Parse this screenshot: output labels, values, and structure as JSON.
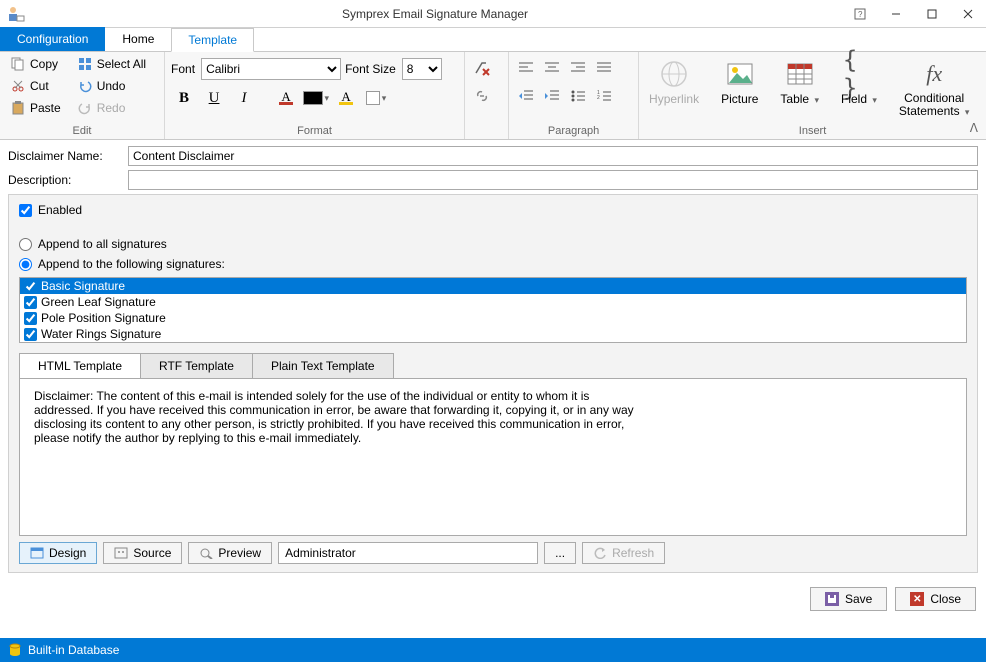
{
  "window": {
    "title": "Symprex Email Signature Manager"
  },
  "tabs": {
    "config": "Configuration",
    "home": "Home",
    "template": "Template"
  },
  "ribbon": {
    "edit": {
      "label": "Edit",
      "copy": "Copy",
      "cut": "Cut",
      "paste": "Paste",
      "select_all": "Select All",
      "undo": "Undo",
      "redo": "Redo"
    },
    "format": {
      "label": "Format",
      "font_label": "Font",
      "font_value": "Calibri",
      "size_label": "Font Size",
      "size_value": "8"
    },
    "paragraph": {
      "label": "Paragraph"
    },
    "insert": {
      "label": "Insert",
      "hyperlink": "Hyperlink",
      "picture": "Picture",
      "table": "Table",
      "field": "Field",
      "conditional": "Conditional",
      "statements": "Statements"
    }
  },
  "form": {
    "name_label": "Disclaimer Name:",
    "name_value": "Content Disclaimer",
    "desc_label": "Description:",
    "desc_value": "",
    "enabled": "Enabled",
    "append_all": "Append to all signatures",
    "append_following": "Append to the following signatures:"
  },
  "signatures": [
    {
      "label": "Basic Signature",
      "checked": true,
      "selected": true
    },
    {
      "label": "Green Leaf Signature",
      "checked": true,
      "selected": false
    },
    {
      "label": "Pole Position Signature",
      "checked": true,
      "selected": false
    },
    {
      "label": "Water Rings Signature",
      "checked": true,
      "selected": false
    }
  ],
  "tpl_tabs": {
    "html": "HTML Template",
    "rtf": "RTF Template",
    "plain": "Plain Text Template"
  },
  "disclaimer_text": "Disclaimer: The content of this e-mail is intended solely for the use of the individual or entity to whom it is addressed. If you have received this communication in error, be aware that forwarding it, copying it, or in any way disclosing its content to any other person, is strictly prohibited. If you have received this communication in error, please notify the author by replying to this e-mail immediately.",
  "design_bar": {
    "design": "Design",
    "source": "Source",
    "preview": "Preview",
    "user": "Administrator",
    "browse": "...",
    "refresh": "Refresh"
  },
  "footer": {
    "save": "Save",
    "close": "Close"
  },
  "status": "Built-in Database"
}
